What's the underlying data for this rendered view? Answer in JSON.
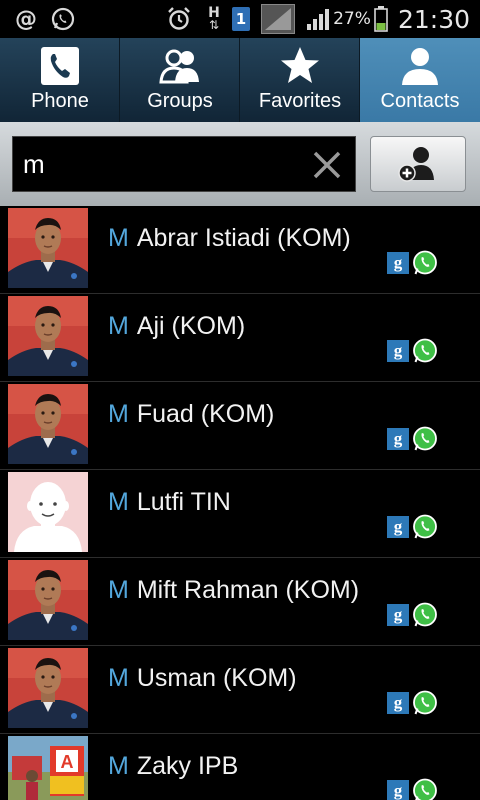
{
  "status": {
    "at_icon": "@",
    "battery_percent": "27%",
    "time": "21:30",
    "network_type": "H",
    "sim_slot": "1"
  },
  "tabs": [
    {
      "label": "Phone",
      "icon": "phone-icon",
      "active": false
    },
    {
      "label": "Groups",
      "icon": "groups-icon",
      "active": false
    },
    {
      "label": "Favorites",
      "icon": "star-icon",
      "active": false
    },
    {
      "label": "Contacts",
      "icon": "person-icon",
      "active": true
    }
  ],
  "search": {
    "value": "m"
  },
  "contacts": [
    {
      "prefix": "M",
      "name": "Abrar Istiadi (KOM)",
      "photo": "photo"
    },
    {
      "prefix": "M",
      "name": "Aji (KOM)",
      "photo": "photo"
    },
    {
      "prefix": "M",
      "name": "Fuad (KOM)",
      "photo": "photo"
    },
    {
      "prefix": "M",
      "name": "Lutfi TIN",
      "photo": "default"
    },
    {
      "prefix": "M",
      "name": "Mift Rahman (KOM)",
      "photo": "photo"
    },
    {
      "prefix": "M",
      "name": "Usman (KOM)",
      "photo": "photo"
    },
    {
      "prefix": "M",
      "name": "Zaky IPB",
      "photo": "outdoor"
    }
  ],
  "badges": {
    "google": "g"
  },
  "colors": {
    "highlight": "#53a7dc",
    "active_tab": "#4f8fb9",
    "whatsapp": "#3fbf46",
    "google": "#2d79b8"
  }
}
